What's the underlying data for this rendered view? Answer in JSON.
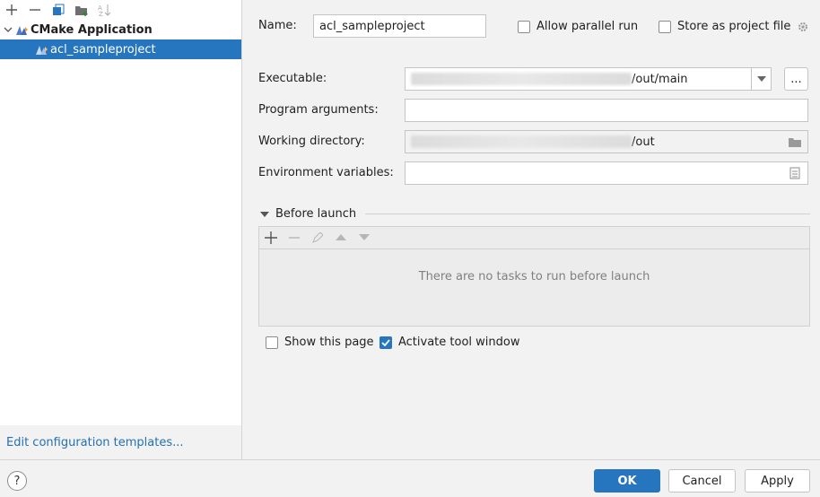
{
  "toolbar": {
    "icons": [
      "add-icon",
      "remove-icon",
      "copy-icon",
      "new-folder-icon",
      "sort-icon"
    ]
  },
  "tree": {
    "group_label": "CMake Application",
    "child_label": "acl_sampleproject"
  },
  "left_footer": {
    "link": "Edit configuration templates..."
  },
  "form": {
    "name_label": "Name:",
    "name_value": "acl_sampleproject",
    "allow_parallel_label": "Allow parallel run",
    "store_project_label": "Store as project file",
    "executable_label": "Executable:",
    "executable_value_suffix": "/out/main",
    "browse_label": "...",
    "program_args_label": "Program arguments:",
    "program_args_value": "",
    "working_dir_label": "Working directory:",
    "working_dir_value_suffix": "/out",
    "env_vars_label": "Environment variables:",
    "env_vars_value": ""
  },
  "before_launch": {
    "title": "Before launch",
    "empty_text": "There are no tasks to run before launch"
  },
  "options": {
    "show_page_label": "Show this page",
    "show_page_checked": false,
    "activate_tool_label": "Activate tool window",
    "activate_tool_checked": true
  },
  "buttons": {
    "help": "?",
    "ok": "OK",
    "cancel": "Cancel",
    "apply": "Apply"
  },
  "colors": {
    "accent": "#2675bf",
    "link": "#2470b3",
    "selection": "#2675bf"
  }
}
